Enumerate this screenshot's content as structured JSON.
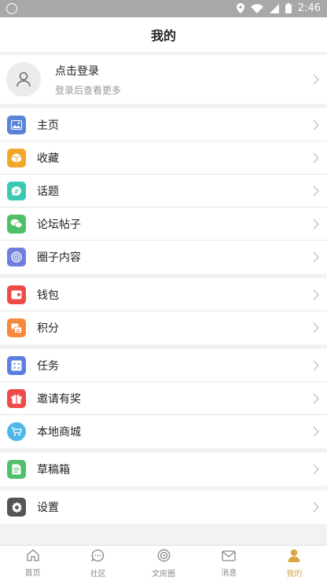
{
  "status": {
    "time": "2:46"
  },
  "header": {
    "title": "我的"
  },
  "profile": {
    "login": "点击登录",
    "subtitle": "登录后查看更多"
  },
  "groups": [
    [
      {
        "label": "主页",
        "color": "#5b84d8",
        "icon": "image-icon"
      },
      {
        "label": "收藏",
        "color": "#f2a72b",
        "icon": "box-icon"
      },
      {
        "label": "话题",
        "color": "#3bc9b4",
        "icon": "hashtag-icon"
      },
      {
        "label": "论坛帖子",
        "color": "#4fbf6a",
        "icon": "chat-icon"
      },
      {
        "label": "圈子内容",
        "color": "#6f7fe0",
        "icon": "circle-icon"
      }
    ],
    [
      {
        "label": "钱包",
        "color": "#ee4a4a",
        "icon": "wallet-icon"
      },
      {
        "label": "积分",
        "color": "#f58a3c",
        "icon": "points-icon"
      }
    ],
    [
      {
        "label": "任务",
        "color": "#5b7fe0",
        "icon": "task-icon"
      },
      {
        "label": "邀请有奖",
        "color": "#ee4a4a",
        "icon": "gift-icon"
      },
      {
        "label": "本地商城",
        "color": "#4db7ea",
        "icon": "cart-icon"
      }
    ],
    [
      {
        "label": "草稿箱",
        "color": "#4fbf6a",
        "icon": "draft-icon"
      }
    ],
    [
      {
        "label": "设置",
        "color": "#555555",
        "icon": "gear-icon"
      }
    ]
  ],
  "tabs": [
    {
      "label": "首页",
      "icon": "home-icon",
      "active": false
    },
    {
      "label": "社区",
      "icon": "community-icon",
      "active": false
    },
    {
      "label": "文房圈",
      "icon": "circle-tab-icon",
      "active": false
    },
    {
      "label": "消息",
      "icon": "message-icon",
      "active": false
    },
    {
      "label": "我的",
      "icon": "person-icon",
      "active": true
    }
  ],
  "colors": {
    "accent": "#d9a443",
    "statusbar": "#a8a8a8"
  }
}
